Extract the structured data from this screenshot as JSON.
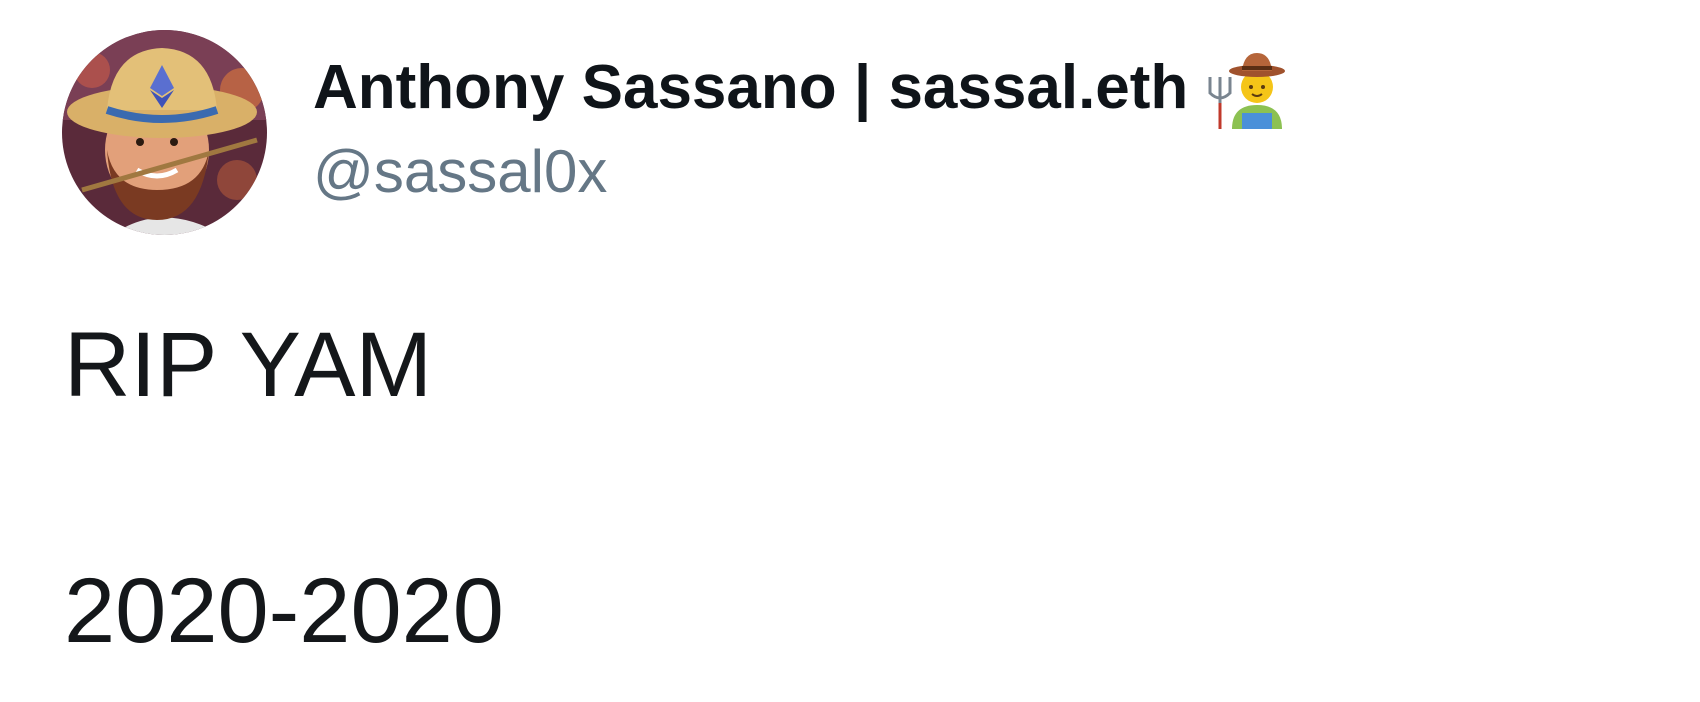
{
  "author": {
    "display_name": "Anthony Sassano | sassal.eth",
    "handle": "@sassal0x",
    "name_emoji": "farmer-emoji",
    "avatar": "avatar-photo-cowboy-hat"
  },
  "tweet": {
    "lines": [
      "RIP YAM",
      "2020-2020"
    ]
  },
  "colors": {
    "name": "#0f1419",
    "handle": "#657786",
    "text": "#14171a",
    "background": "#ffffff"
  }
}
